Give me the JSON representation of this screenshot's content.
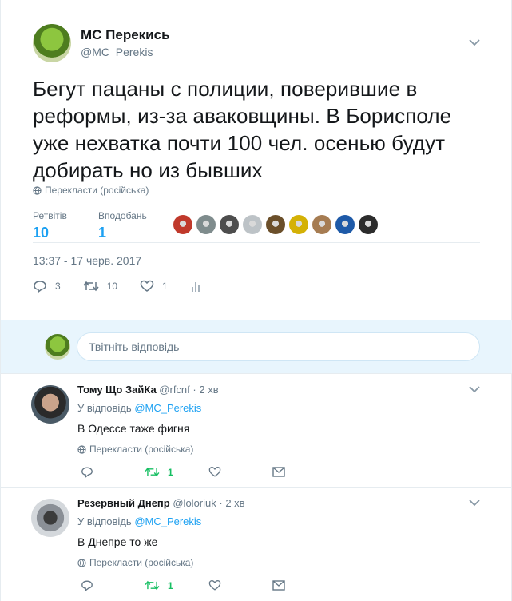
{
  "tweet": {
    "author_name": "МС Перекись",
    "author_handle": "@MC_Perekis",
    "text": "Бегут пацаны с полиции, поверившие в реформы, из-за аваковщины. В Борисполе уже нехватка почти 100 чел. осенью будут добирать но из бывших",
    "translate_label": "Перекласти (російська)",
    "retweets_label": "Ретвітів",
    "retweets_count": "10",
    "likes_label": "Вподобань",
    "likes_count": "1",
    "timestamp": "13:37 - 17 черв. 2017",
    "reply_count": "3",
    "retweet_count_action": "10",
    "like_count_action": "1"
  },
  "liker_colors": [
    "#c0392b",
    "#7f8c8d",
    "#4d4d4d",
    "#bdc3c7",
    "#6b4f2a",
    "#d4b106",
    "#a67c52",
    "#1e5aa8",
    "#2c2c2c"
  ],
  "reply_box": {
    "placeholder": "Твітніть відповідь"
  },
  "replies": [
    {
      "name": "Тому Що ЗайКа",
      "handle": "@rfcnf",
      "time": "2 хв",
      "reply_prefix": "У відповідь",
      "reply_to": "@MC_Perekis",
      "text": "В Одессе таже фигня",
      "translate_label": "Перекласти (російська)",
      "retweets": "1"
    },
    {
      "name": "Резервный Днепр",
      "handle": "@loloriuk",
      "time": "2 хв",
      "reply_prefix": "У відповідь",
      "reply_to": "@MC_Perekis",
      "text": "В Днепре то же",
      "translate_label": "Перекласти (російська)",
      "retweets": "1"
    }
  ],
  "colors": {
    "accent": "#1da1f2",
    "retweet": "#17bf63",
    "muted": "#657786"
  }
}
